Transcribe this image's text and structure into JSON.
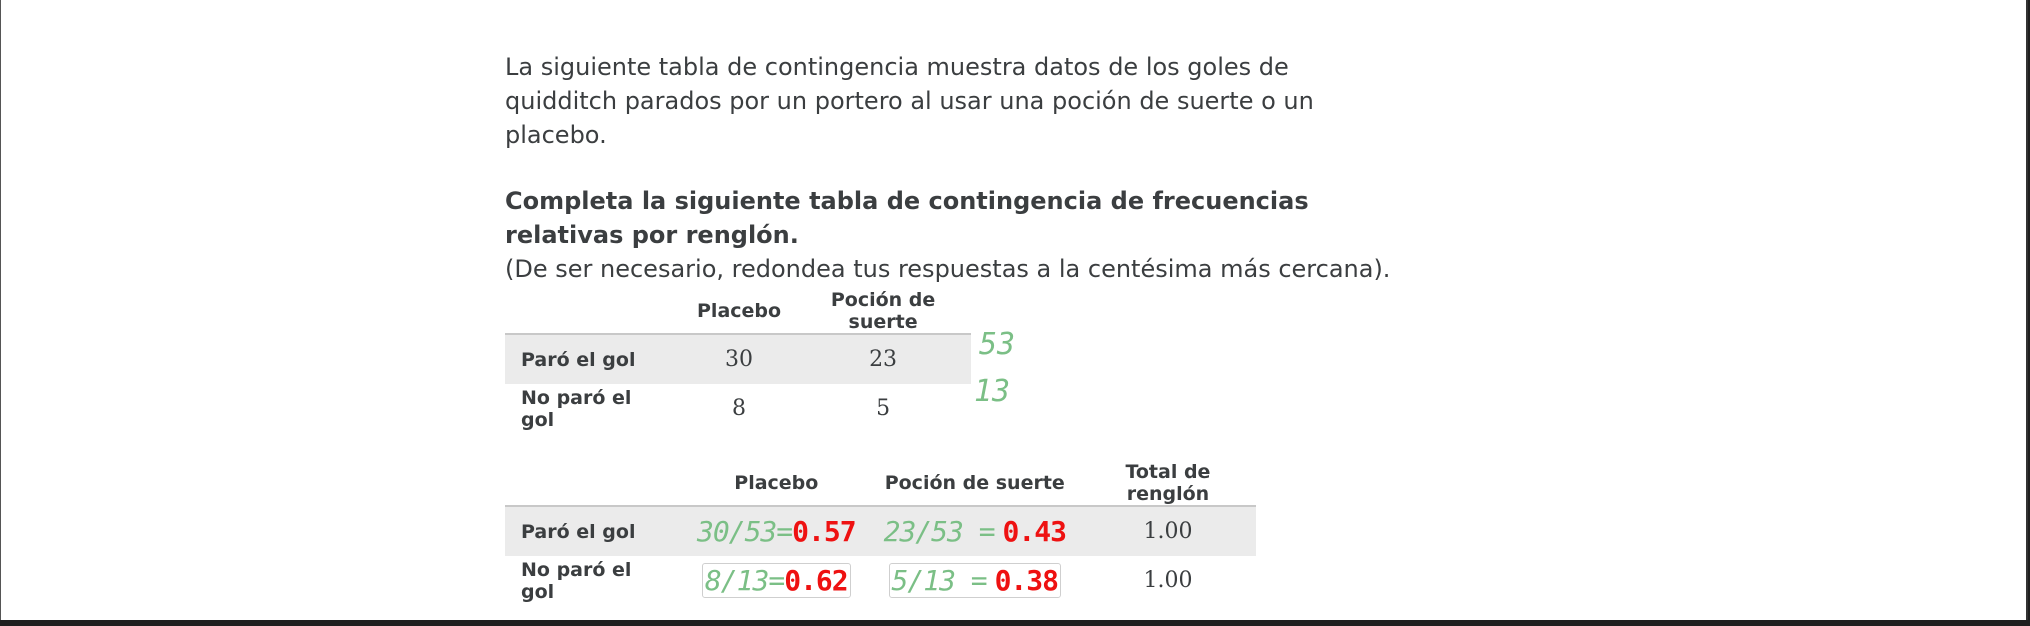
{
  "intro": "La siguiente tabla de contingencia muestra datos de los goles de quidditch parados por un portero al usar una poción de suerte o un placebo.",
  "instruction": "Completa la siguiente tabla de contingencia de frecuencias relativas por renglón.",
  "note": "(De ser necesario, redondea tus respuestas a la centésima más cercana).",
  "table1": {
    "headers": [
      "Placebo",
      "Poción de suerte"
    ],
    "rows": [
      {
        "label": "Paró el gol",
        "values": [
          "30",
          "23"
        ]
      },
      {
        "label": "No paró el gol",
        "values": [
          "8",
          "5"
        ]
      }
    ]
  },
  "annotations": {
    "row1_total": "53",
    "row2_total": "13"
  },
  "table2": {
    "headers": [
      "Placebo",
      "Poción de suerte",
      "Total de renglón"
    ],
    "rows": [
      {
        "label": "Paró el gol",
        "placebo": {
          "work": "30/53=",
          "answer": "0.57"
        },
        "pocion": {
          "work": "23/53 =",
          "answer": "0.43"
        },
        "total": "1.00"
      },
      {
        "label": "No paró el gol",
        "placebo": {
          "work": "8/13=",
          "answer": "0.62"
        },
        "pocion": {
          "work": "5/13 =",
          "answer": "0.38"
        },
        "total": "1.00"
      }
    ]
  },
  "colors": {
    "annotation_green": "#7bbf86",
    "annotation_red": "#ee1111",
    "row_shade": "#ebebeb"
  }
}
